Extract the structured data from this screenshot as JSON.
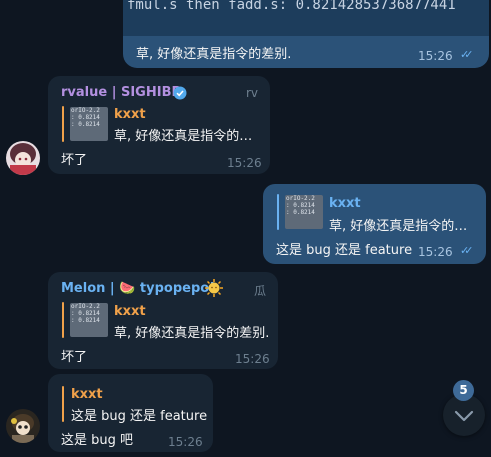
{
  "colors": {
    "background": "#0e1621",
    "incoming_bubble": "#182533",
    "outgoing_bubble": "#2b5278",
    "link_blue": "#6ab2f2",
    "sender_purple": "#b390e0",
    "verified_blue": "#52a9ec",
    "quote_orange": "#f0a14a",
    "badge": "#3e6a98"
  },
  "top_message": {
    "code_line": "fmul.s then fadd.s: 0.82142853736877441",
    "text": "草, 好像还真是指令的差别.",
    "time": "15:26",
    "status_icon": "double-check-icon"
  },
  "msg1": {
    "sender": "rvalue | SIGHIBR",
    "verified_icon": "verified-badge-icon",
    "role": "rv",
    "thumb_text": "orIO-2.2\n: 0.8214\n: 0.8214",
    "quote_name": "kxxt",
    "quote_text": "草, 好像还真是指令的…",
    "text": "坏了",
    "time": "15:26"
  },
  "msg2": {
    "thumb_text": "orIO-2.2\n: 0.8214\n: 0.8214",
    "quote_name": "kxxt",
    "quote_text": "草, 好像还真是指令的…",
    "text": "这是 bug 还是 feature",
    "time": "15:26",
    "status_icon": "double-check-icon"
  },
  "msg3": {
    "sender_prefix": "Melon | ",
    "sender_emoji": "🍉",
    "sender_suffix": " typopepo!",
    "sender_emoji2": "🌞",
    "role": "瓜",
    "thumb_text": "orIO-2.2\n: 0.8214\n: 0.8214",
    "quote_name": "kxxt",
    "quote_text": "草, 好像还真是指令的差别.",
    "text": "坏了",
    "time": "15:26"
  },
  "msg4": {
    "quote_name": "kxxt",
    "quote_text": "这是 bug 还是 feature",
    "text": "这是 bug 吧",
    "time": "15:26"
  },
  "scroll": {
    "unread_count": "5",
    "icon": "chevron-down-icon"
  }
}
